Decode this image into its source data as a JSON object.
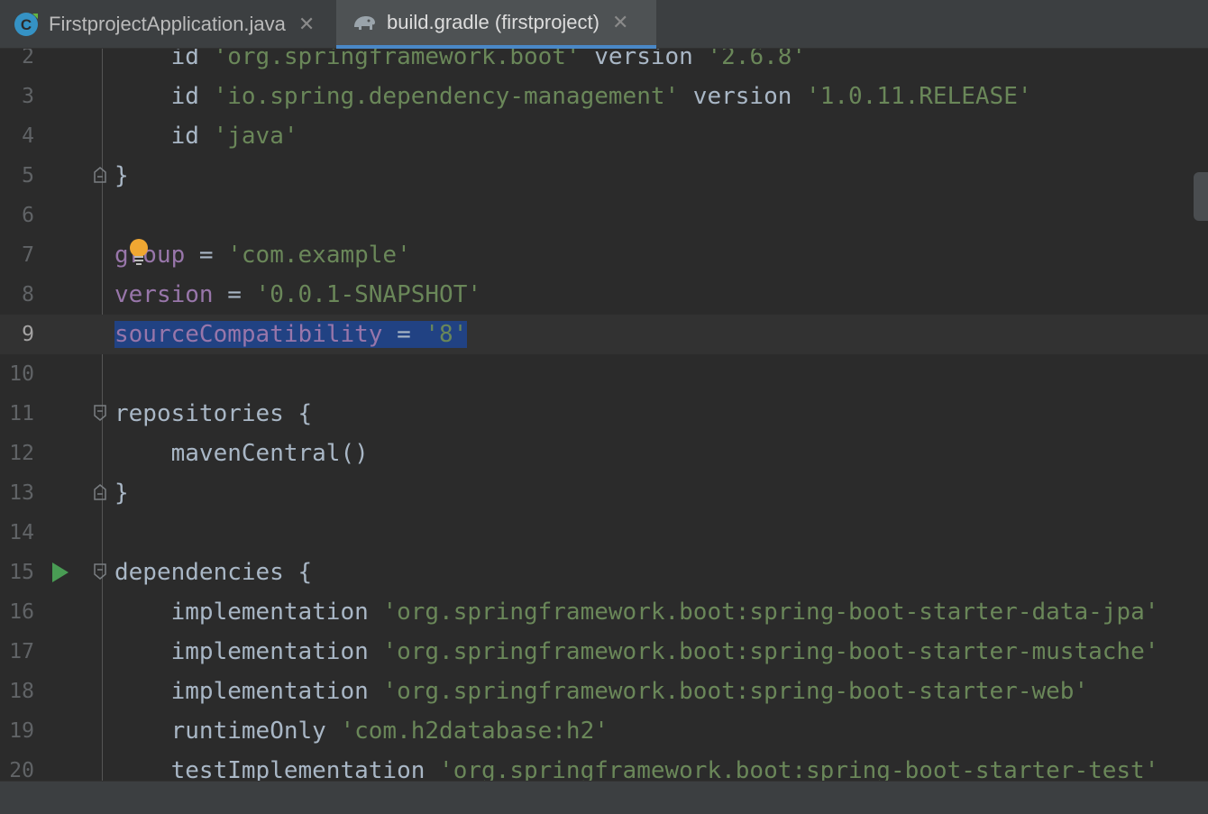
{
  "tabs": [
    {
      "label": "FirstprojectApplication.java",
      "icon": "java-class-icon",
      "active": false
    },
    {
      "label": "build.gradle (firstproject)",
      "icon": "gradle-elephant-icon",
      "active": true
    }
  ],
  "close_glyph": "✕",
  "editor": {
    "current_line": "9",
    "lines": [
      {
        "n": "2",
        "indent": "    ",
        "parts": [
          {
            "t": "id ",
            "c": "kw"
          },
          {
            "t": "'org.springframework.boot'",
            "c": "str"
          },
          {
            "t": " version ",
            "c": "kw"
          },
          {
            "t": "'2.6.8'",
            "c": "str"
          }
        ]
      },
      {
        "n": "3",
        "indent": "    ",
        "parts": [
          {
            "t": "id ",
            "c": "kw"
          },
          {
            "t": "'io.spring.dependency-management'",
            "c": "str"
          },
          {
            "t": " version ",
            "c": "kw"
          },
          {
            "t": "'1.0.11.RELEASE'",
            "c": "str"
          }
        ]
      },
      {
        "n": "4",
        "indent": "    ",
        "parts": [
          {
            "t": "id ",
            "c": "kw"
          },
          {
            "t": "'java'",
            "c": "str"
          }
        ]
      },
      {
        "n": "5",
        "indent": "",
        "parts": [
          {
            "t": "}",
            "c": "kw"
          }
        ],
        "fold": "end"
      },
      {
        "n": "6",
        "indent": "",
        "parts": []
      },
      {
        "n": "7",
        "indent": "",
        "parts": [
          {
            "t": "group",
            "c": "prop"
          },
          {
            "t": " = ",
            "c": "kw"
          },
          {
            "t": "'com.example'",
            "c": "str"
          }
        ]
      },
      {
        "n": "8",
        "indent": "",
        "parts": [
          {
            "t": "version",
            "c": "prop"
          },
          {
            "t": " = ",
            "c": "kw"
          },
          {
            "t": "'0.0.1-SNAPSHOT'",
            "c": "str"
          }
        ]
      },
      {
        "n": "9",
        "indent": "",
        "parts": [
          {
            "t": "sourceCompatibility",
            "c": "prop sel"
          },
          {
            "t": " = ",
            "c": "kw sel"
          },
          {
            "t": "'8'",
            "c": "str sel"
          }
        ]
      },
      {
        "n": "10",
        "indent": "",
        "parts": []
      },
      {
        "n": "11",
        "indent": "",
        "parts": [
          {
            "t": "repositories {",
            "c": "kw"
          }
        ],
        "fold": "start"
      },
      {
        "n": "12",
        "indent": "    ",
        "parts": [
          {
            "t": "mavenCentral()",
            "c": "kw"
          }
        ]
      },
      {
        "n": "13",
        "indent": "",
        "parts": [
          {
            "t": "}",
            "c": "kw"
          }
        ],
        "fold": "end"
      },
      {
        "n": "14",
        "indent": "",
        "parts": []
      },
      {
        "n": "15",
        "indent": "",
        "parts": [
          {
            "t": "dependencies {",
            "c": "kw"
          }
        ],
        "fold": "start",
        "run": true
      },
      {
        "n": "16",
        "indent": "    ",
        "parts": [
          {
            "t": "implementation ",
            "c": "kw"
          },
          {
            "t": "'org.springframework.boot:spring-boot-starter-data-jpa'",
            "c": "str"
          }
        ]
      },
      {
        "n": "17",
        "indent": "    ",
        "parts": [
          {
            "t": "implementation ",
            "c": "kw"
          },
          {
            "t": "'org.springframework.boot:spring-boot-starter-mustache'",
            "c": "str"
          }
        ]
      },
      {
        "n": "18",
        "indent": "    ",
        "parts": [
          {
            "t": "implementation ",
            "c": "kw"
          },
          {
            "t": "'org.springframework.boot:spring-boot-starter-web'",
            "c": "str"
          }
        ]
      },
      {
        "n": "19",
        "indent": "    ",
        "parts": [
          {
            "t": "runtimeOnly ",
            "c": "kw"
          },
          {
            "t": "'com.h2database:h2'",
            "c": "str"
          }
        ]
      },
      {
        "n": "20",
        "indent": "    ",
        "parts": [
          {
            "t": "testImplementation ",
            "c": "kw"
          },
          {
            "t": "'org.springframework.boot:spring-boot-starter-test'",
            "c": "str"
          }
        ]
      }
    ]
  },
  "colors": {
    "keyword": "#a9b7c6",
    "string": "#6a8759",
    "property": "#9876aa",
    "selection": "#214283",
    "active_tab_underline": "#4a88c7"
  },
  "icons": {
    "intention_bulb": "lightbulb-icon",
    "run_gutter": "run-gutter-icon",
    "fold": "fold-marker-icon"
  }
}
